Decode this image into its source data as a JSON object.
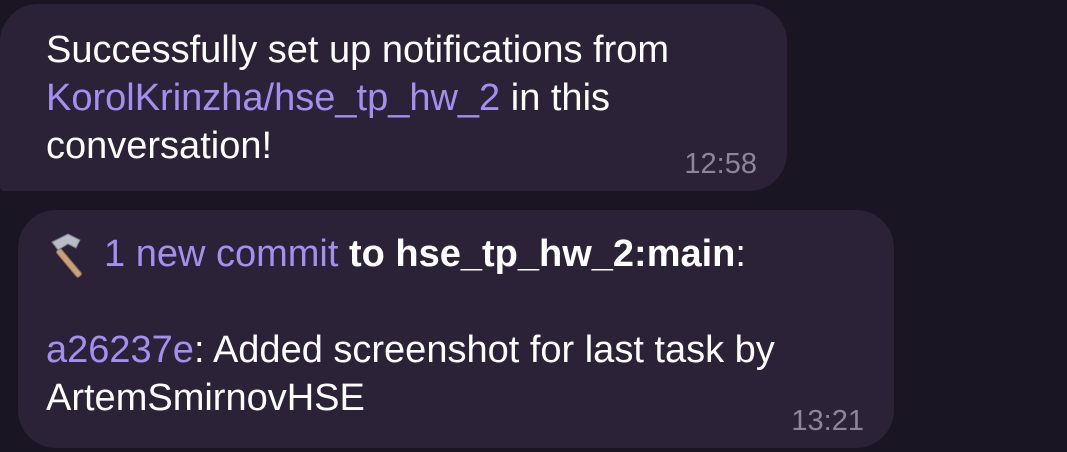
{
  "messages": [
    {
      "text_before_link": "Successfully set up notifications from",
      "link": "KorolKrinzha/hse_tp_hw_2",
      "text_after_link": " in this",
      "text_end": "conversation!",
      "time": "12:58"
    },
    {
      "icon": "hammer-icon",
      "commit_link": "1 new commit",
      "commit_target": " to hse_tp_hw_2:main",
      "commit_colon": ":",
      "hash": "a26237e",
      "commit_message_line1": ": Added screenshot for last task by",
      "commit_message_line2": "ArtemSmirnovHSE",
      "time": "13:21"
    }
  ],
  "colors": {
    "background": "#1a1523",
    "bubble": "#2b2238",
    "link": "#a58ef0",
    "timestamp": "#8e8698"
  }
}
